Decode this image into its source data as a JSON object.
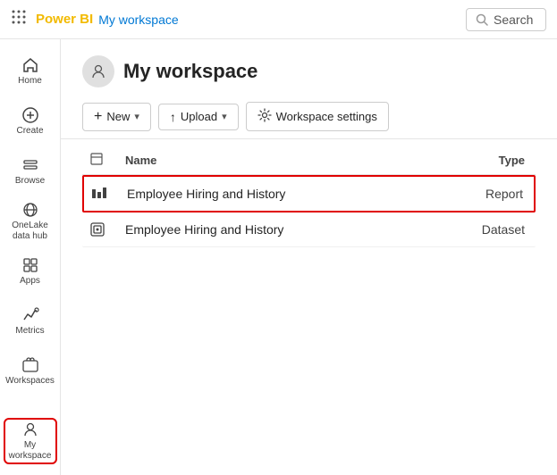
{
  "topbar": {
    "brand": "Power BI",
    "workspace_link": "My workspace",
    "search_placeholder": "Search"
  },
  "sidebar": {
    "items": [
      {
        "id": "home",
        "label": "Home"
      },
      {
        "id": "create",
        "label": "Create"
      },
      {
        "id": "browse",
        "label": "Browse"
      },
      {
        "id": "onelake",
        "label": "OneLake\ndata hub"
      },
      {
        "id": "apps",
        "label": "Apps"
      },
      {
        "id": "metrics",
        "label": "Metrics"
      },
      {
        "id": "workspaces",
        "label": "Workspaces"
      },
      {
        "id": "myworkspace",
        "label": "My\nworkspace"
      }
    ]
  },
  "workspace": {
    "title": "My workspace",
    "toolbar": {
      "new_label": "New",
      "upload_label": "Upload",
      "settings_label": "Workspace settings"
    },
    "table": {
      "col_name": "Name",
      "col_type": "Type",
      "rows": [
        {
          "name": "Employee Hiring and History",
          "type": "Report",
          "highlighted": true,
          "icon": "report"
        },
        {
          "name": "Employee Hiring and History",
          "type": "Dataset",
          "highlighted": false,
          "icon": "dataset"
        }
      ]
    }
  }
}
